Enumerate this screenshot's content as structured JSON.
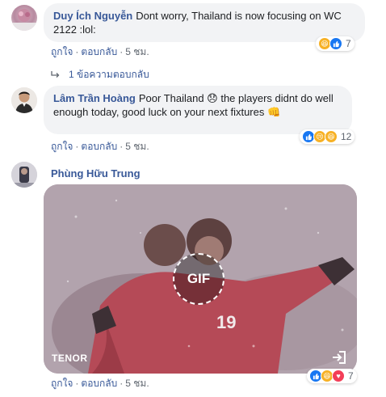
{
  "comments": [
    {
      "author": "Duy Ích Nguyễn",
      "text": "Dont worry, Thailand is now focusing on WC 2122 :lol:",
      "actions": {
        "like": "ถูกใจ",
        "reply": "ตอบกลับ",
        "time": "5 ชม."
      },
      "reactions": {
        "icons": [
          "haha-icon",
          "like-icon"
        ],
        "count": "7"
      },
      "replies_label": "1 ข้อความตอบกลับ"
    },
    {
      "author": "Lâm Trần Hoàng",
      "text": "Poor Thailand 😞 the players didnt do well enough today, good luck on your next fixtures 👊",
      "actions": {
        "like": "ถูกใจ",
        "reply": "ตอบกลับ",
        "time": "5 ชม."
      },
      "reactions": {
        "icons": [
          "like-icon",
          "sad-icon",
          "haha-icon"
        ],
        "count": "12"
      }
    },
    {
      "author": "Phùng Hữu Trung",
      "gif": {
        "badge": "GIF",
        "source": "TENOR",
        "jersey": "19"
      },
      "actions": {
        "like": "ถูกใจ",
        "reply": "ตอบกลับ",
        "time": "5 ชม."
      },
      "reactions": {
        "icons": [
          "like-icon",
          "haha-icon",
          "love-icon"
        ],
        "count": "7"
      }
    }
  ],
  "colors": {
    "link": "#385898",
    "bubble": "#f2f3f5",
    "like": "#1877f2",
    "haha": "#f7b125",
    "love": "#f33e58"
  }
}
